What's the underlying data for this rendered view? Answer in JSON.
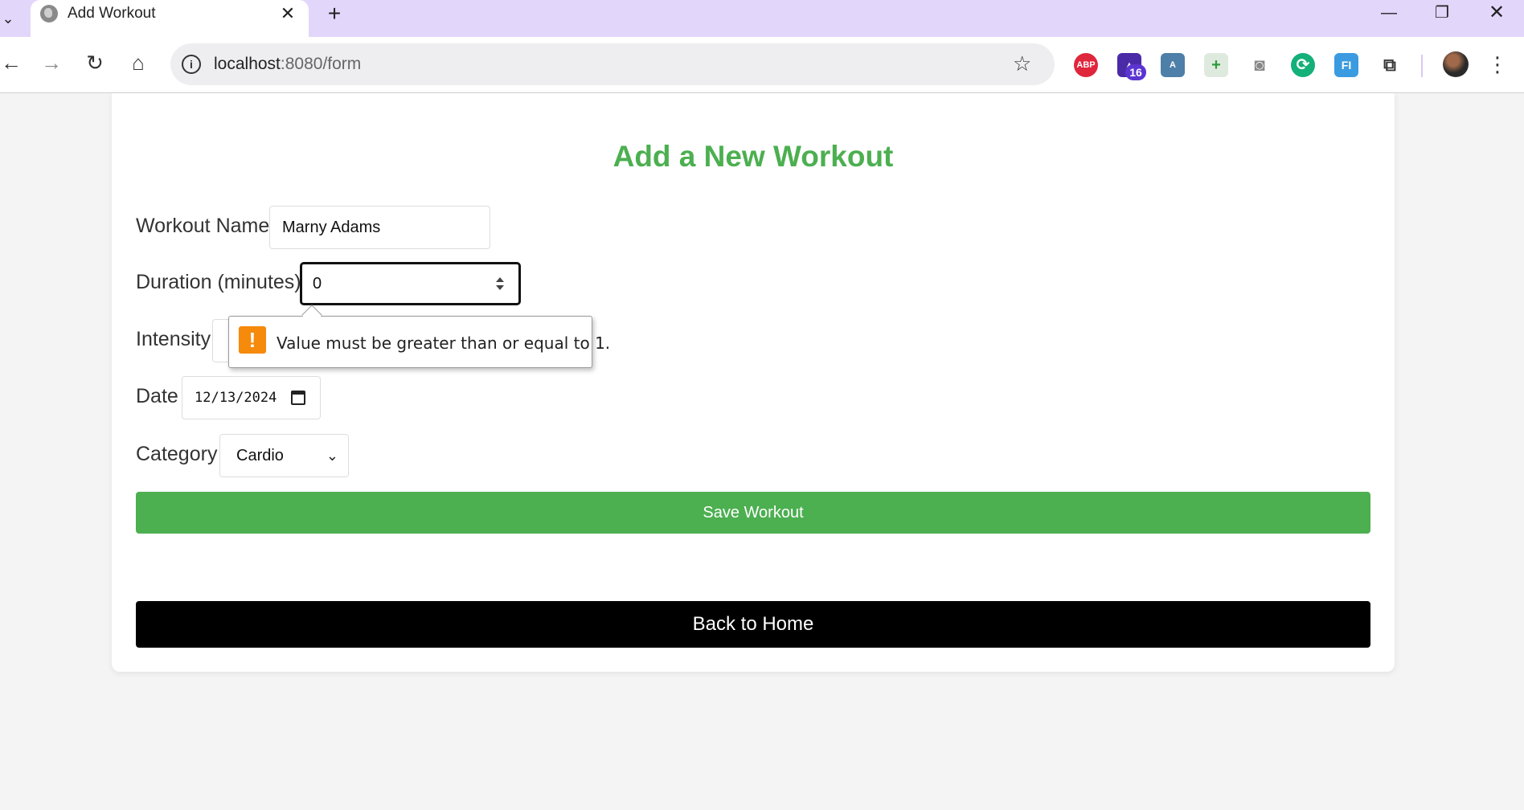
{
  "browser": {
    "tab_title": "Add Workout",
    "tab_close": "✕",
    "new_tab": "+",
    "window_controls": {
      "minimize": "—",
      "restore": "❐",
      "close": "✕"
    },
    "url_host": "localhost",
    "url_path": ":8080/form",
    "extensions": {
      "abp_label": "ABP",
      "badge_count": "16",
      "fi_label": "FI"
    }
  },
  "form": {
    "heading": "Add a New Workout",
    "workout_name_label": "Workout Name",
    "workout_name_value": "Marny Adams",
    "duration_label": "Duration (minutes)",
    "duration_value": "0",
    "intensity_label": "Intensity",
    "date_label": "Date",
    "date_value": "12/13/2024",
    "category_label": "Category",
    "category_value": "Cardio",
    "save_button": "Save Workout",
    "home_button": "Back to Home"
  },
  "validation": {
    "message": "Value must be greater than or equal to 1.",
    "icon": "!"
  },
  "colors": {
    "accent_green": "#4caf50",
    "tab_strip": "#e3d6fb",
    "warning_orange": "#f58a0b"
  }
}
